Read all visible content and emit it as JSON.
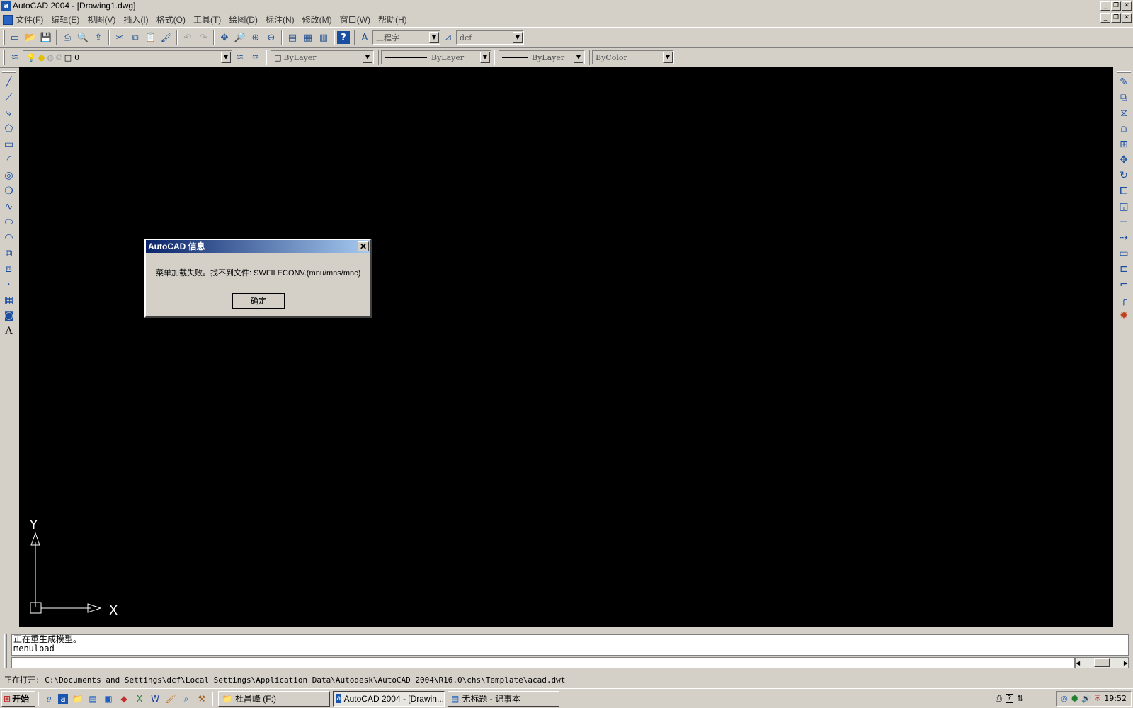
{
  "window": {
    "title": "AutoCAD 2004 - [Drawing1.dwg]"
  },
  "menu": {
    "items": [
      "文件(F)",
      "编辑(E)",
      "视图(V)",
      "插入(I)",
      "格式(O)",
      "工具(T)",
      "绘图(D)",
      "标注(N)",
      "修改(M)",
      "窗口(W)",
      "帮助(H)"
    ]
  },
  "toolbar": {
    "text_style": "工程字",
    "dim_style": "dcf",
    "layer": "0",
    "color": "ByLayer",
    "linetype": "ByLayer",
    "lineweight": "ByLayer",
    "plotstyle": "ByColor"
  },
  "dialog": {
    "title": "AutoCAD 信息",
    "message": "菜单加载失败。找不到文件: SWFILECONV.(mnu/mns/mnc)",
    "ok_label": "确定",
    "close_glyph": "✕"
  },
  "ucs": {
    "x_label": "X",
    "y_label": "Y"
  },
  "command": {
    "line1": "正在重生成模型。",
    "line2": "menuload"
  },
  "status": {
    "text": "正在打开: C:\\Documents and Settings\\dcf\\Local Settings\\Application Data\\Autodesk\\AutoCAD 2004\\R16.0\\chs\\Template\\acad.dwt"
  },
  "taskbar": {
    "start_label": "开始",
    "tasks": [
      "杜昌峰 (F:)",
      "AutoCAD 2004 - [Drawin...",
      "无标题 - 记事本"
    ],
    "clock": "19:52"
  },
  "icons": {
    "left_tools": [
      "line-icon",
      "xline-icon",
      "polyline-icon",
      "polygon-icon",
      "rectangle-icon",
      "arc-icon",
      "circle-icon",
      "revcloud-icon",
      "spline-icon",
      "ellipse-icon",
      "ellipse-arc-icon",
      "insert-block-icon",
      "make-block-icon",
      "point-icon",
      "hatch-icon",
      "region-icon",
      "text-icon"
    ],
    "right_tools": [
      "erase-icon",
      "copy-icon",
      "mirror-icon",
      "offset-icon",
      "array-icon",
      "move-icon",
      "rotate-icon",
      "scale-icon",
      "stretch-icon",
      "trim-icon",
      "extend-icon",
      "break-icon",
      "break-at-point-icon",
      "chamfer-icon",
      "fillet-icon",
      "explode-icon"
    ]
  }
}
